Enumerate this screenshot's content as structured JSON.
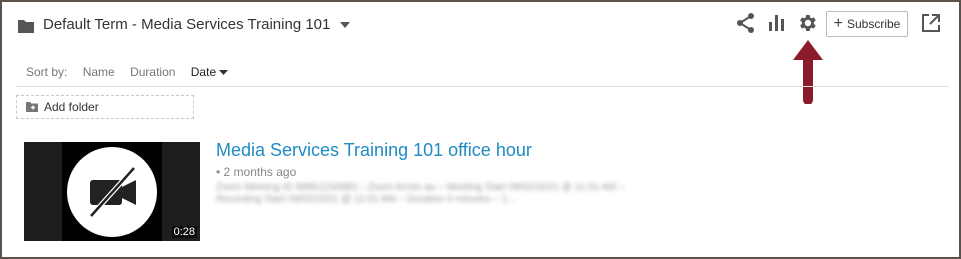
{
  "header": {
    "folder_title": "Default Term - Media Services Training 101",
    "subscribe_label": "Subscribe"
  },
  "icons": {
    "folder": "folder-icon",
    "caret": "caret-down-icon",
    "share": "share-icon",
    "stats": "bar-chart-icon",
    "settings": "gear-icon",
    "plus": "plus-icon",
    "external": "open-external-icon",
    "annotation": "arrow-up-icon"
  },
  "colors": {
    "arrow": "#8b1a2b",
    "link": "#1e8bc3",
    "frame": "#5b524b"
  },
  "sort": {
    "label": "Sort by:",
    "options": [
      "Name",
      "Duration",
      "Date"
    ],
    "active": "Date"
  },
  "add_folder_label": "Add folder",
  "video": {
    "title": "Media Services Training 101 office hour",
    "age": "2 months ago",
    "duration": "0:28",
    "description": "Zoom Meeting ID 98851234883 – Zoom Armin.au – Meeting Start 09/02/2021 @ 11:01 AM – Recording Start 09/02/2021 @ 11:01 AM – Duration 0 minutes – 1..."
  }
}
